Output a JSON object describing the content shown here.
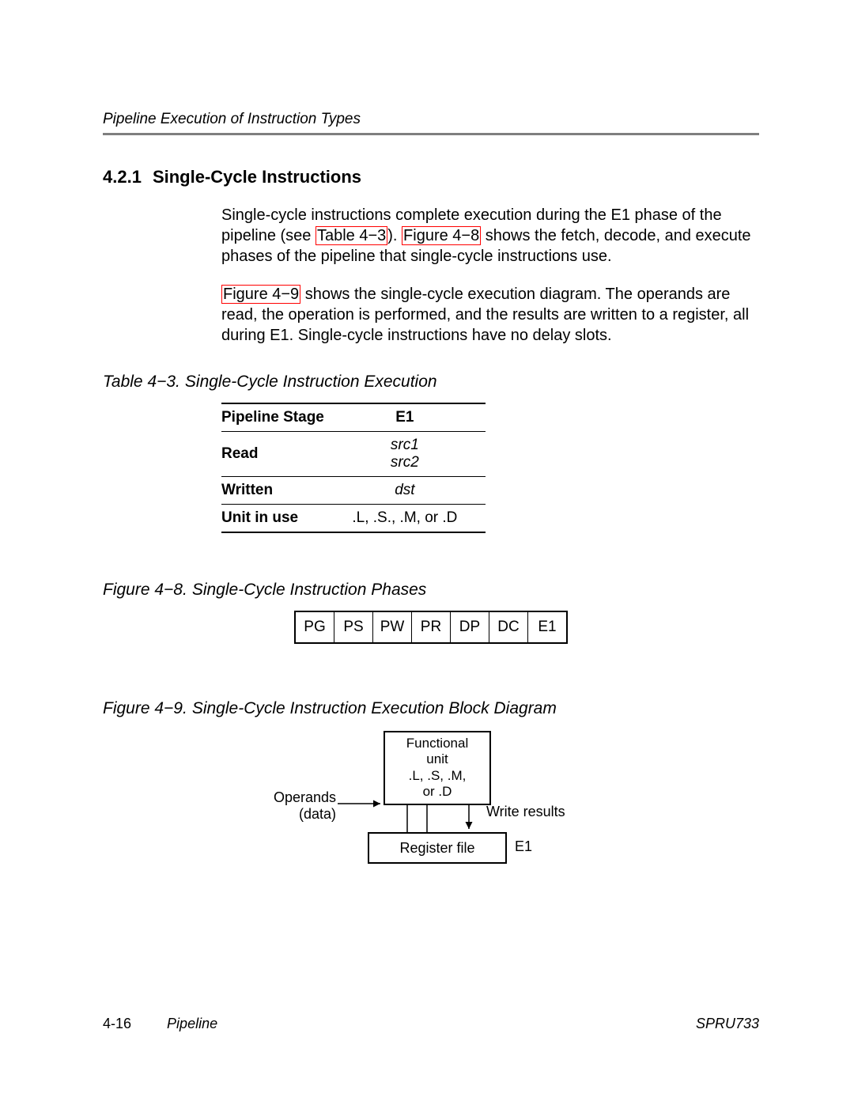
{
  "header": {
    "running_title": "Pipeline Execution of Instruction Types"
  },
  "section": {
    "number": "4.2.1",
    "title": "Single-Cycle Instructions"
  },
  "para1": {
    "a": "Single-cycle instructions complete execution during the E1 phase of the pipeline (see ",
    "ref1": "Table 4−3",
    "b": "). ",
    "ref2": "Figure 4−8",
    "c": " shows the fetch, decode, and execute phases of the pipeline that single-cycle instructions use."
  },
  "para2": {
    "ref1": "Figure 4−9",
    "a": " shows the single-cycle execution diagram. The operands are read, the operation is performed, and the results are written to a register, all during E1. Single-cycle instructions have no delay slots."
  },
  "table43": {
    "caption_num": "Table 4−3.",
    "caption_text": "Single-Cycle Instruction Execution",
    "head_stage": "Pipeline Stage",
    "head_e1": "E1",
    "row_read": "Read",
    "row_read_v1": "src1",
    "row_read_v2": "src2",
    "row_written": "Written",
    "row_written_v": "dst",
    "row_unit": "Unit in use",
    "row_unit_v": ".L, .S., .M, or .D"
  },
  "fig48": {
    "caption_num": "Figure 4−8.",
    "caption_text": "Single-Cycle Instruction Phases",
    "phases": [
      "PG",
      "PS",
      "PW",
      "PR",
      "DP",
      "DC",
      "E1"
    ]
  },
  "fig49": {
    "caption_num": "Figure 4−9.",
    "caption_text": "Single-Cycle Instruction Execution Block Diagram",
    "funit_line1": "Functional",
    "funit_line2": "unit",
    "funit_line3": ".L, .S, .M,",
    "funit_line4": "or .D",
    "operands_l1": "Operands",
    "operands_l2": "(data)",
    "write_results": "Write results",
    "regfile": "Register file",
    "e1": "E1"
  },
  "footer": {
    "page": "4-16",
    "chapter": "Pipeline",
    "docid": "SPRU733"
  }
}
